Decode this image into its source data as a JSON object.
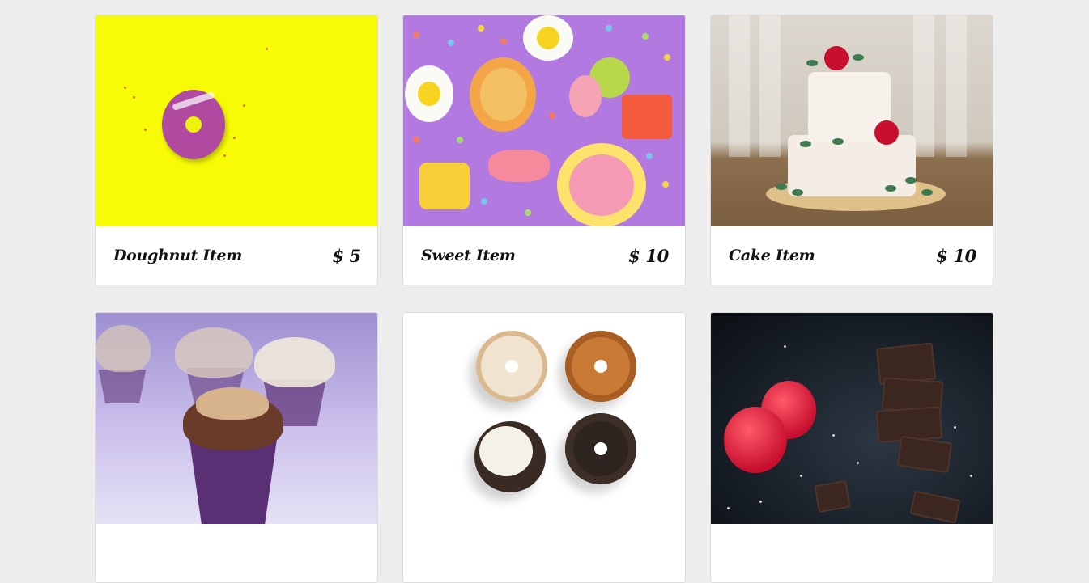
{
  "products": [
    {
      "title": "Doughnut Item",
      "price": "$ 5"
    },
    {
      "title": "Sweet Item",
      "price": "$ 10"
    },
    {
      "title": "Cake Item",
      "price": "$ 10"
    },
    {
      "title": "",
      "price": ""
    },
    {
      "title": "",
      "price": ""
    },
    {
      "title": "",
      "price": ""
    }
  ],
  "colors": {
    "page_background": "#ededed",
    "card_background": "#ffffff"
  }
}
